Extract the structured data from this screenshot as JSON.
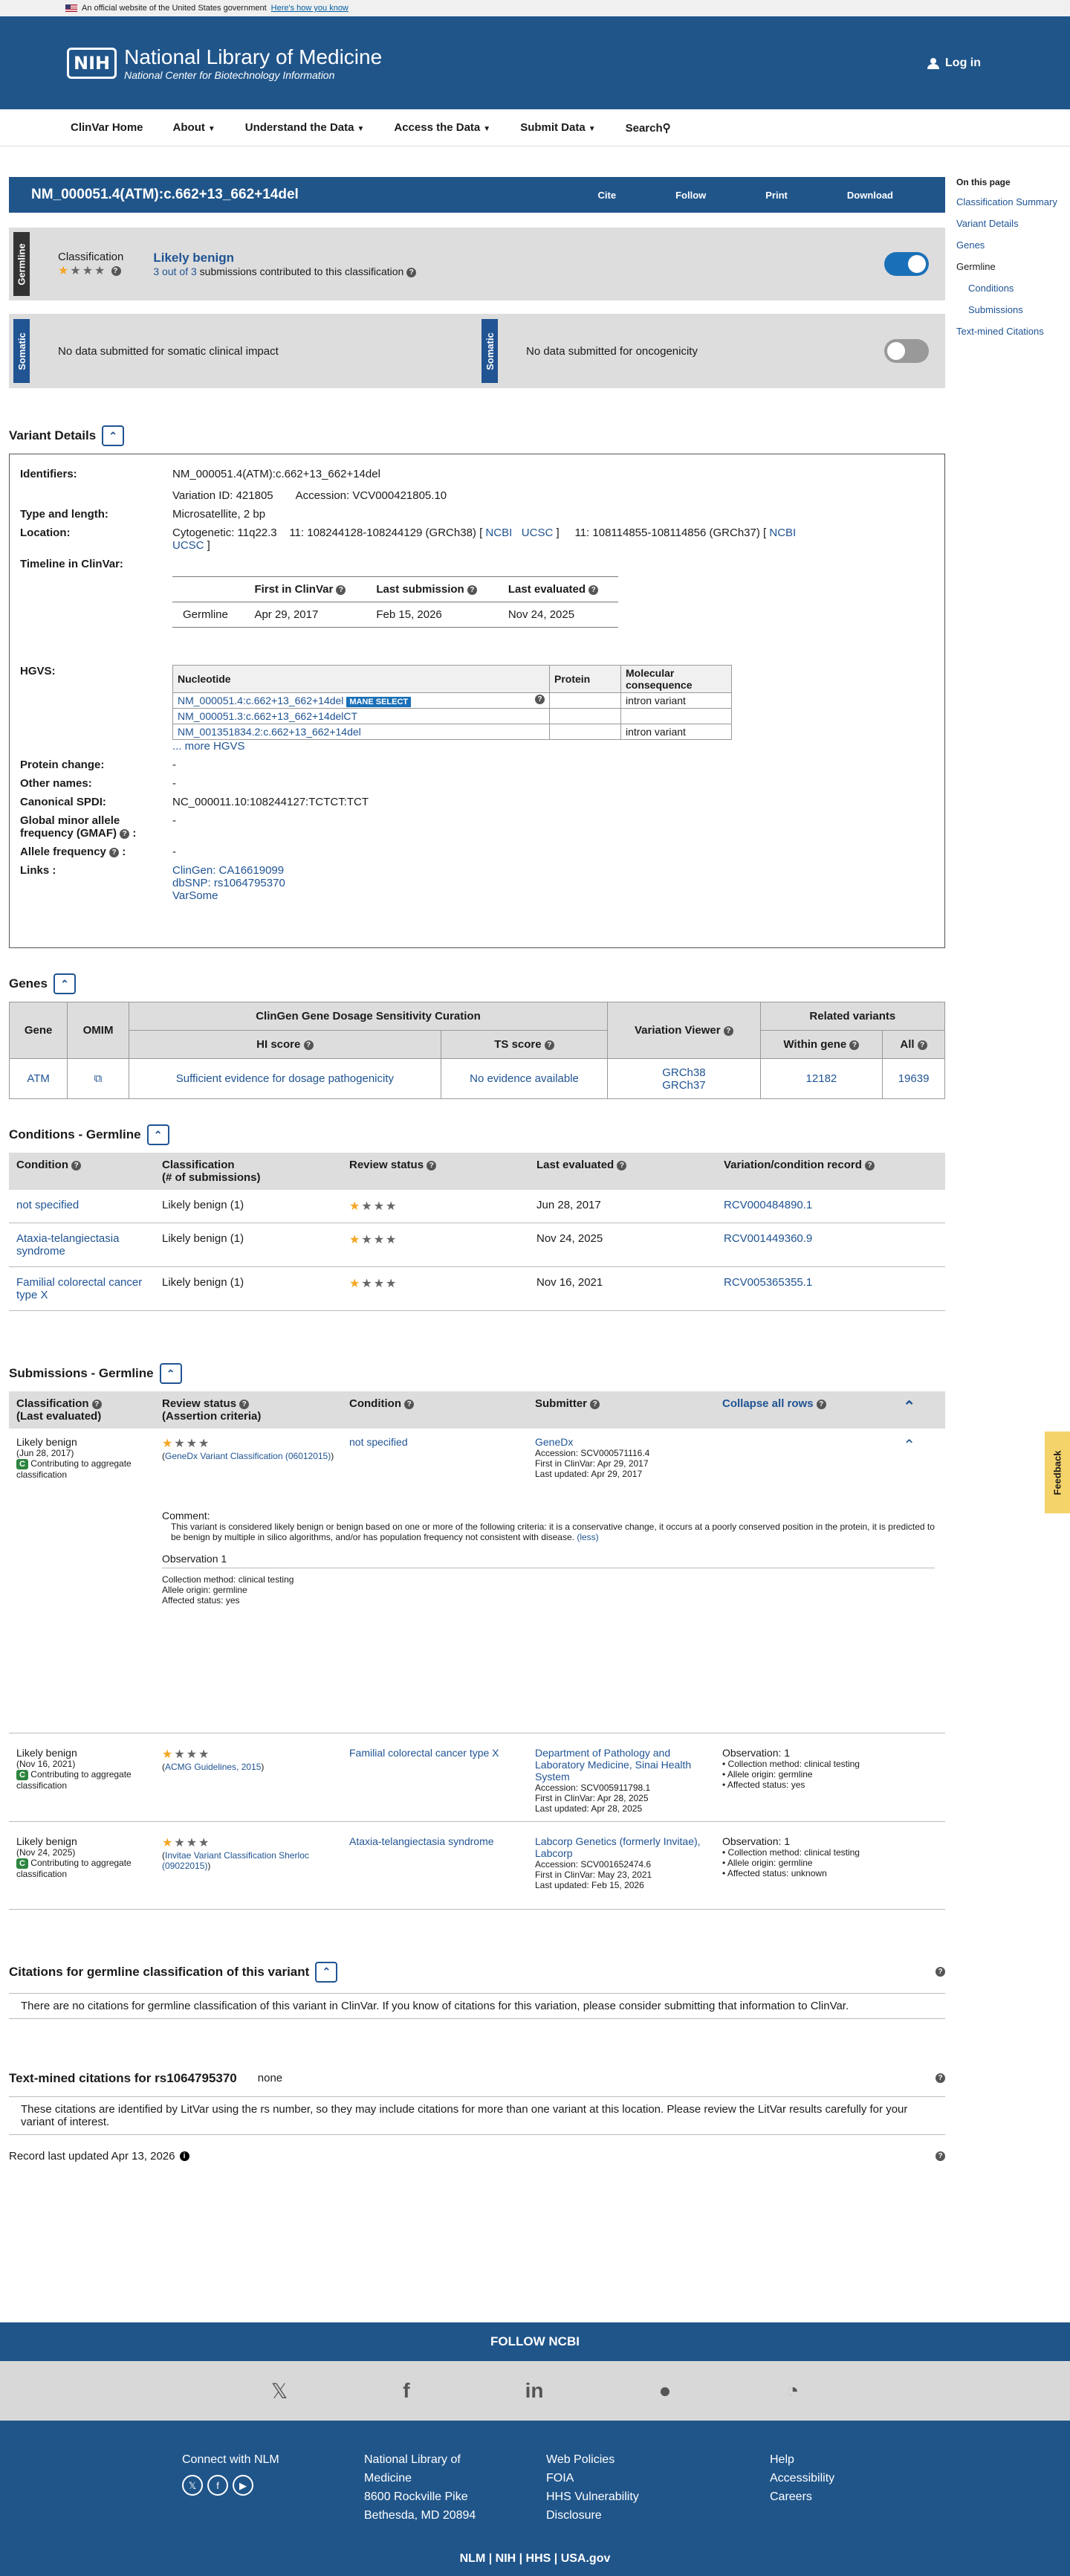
{
  "gov": {
    "text": "An official website of the United States government",
    "link": "Here's how you know"
  },
  "header": {
    "logo": "NIH",
    "title": "National Library of Medicine",
    "subtitle": "National Center for Biotechnology Information",
    "login": "Log in"
  },
  "nav": [
    "ClinVar Home",
    "About",
    "Understand the Data",
    "Access the Data",
    "Submit Data",
    "Search"
  ],
  "variant": {
    "title": "NM_000051.4(ATM):c.662+13_662+14del",
    "actions": [
      "Cite",
      "Follow",
      "Print",
      "Download"
    ]
  },
  "germline": {
    "tag": "Germline",
    "label": "Classification",
    "value": "Likely benign",
    "count": "3 out of 3",
    "count_rest": " submissions contributed to this classification",
    "stars_on": 1
  },
  "somatic": {
    "tag": "Somatic",
    "left": "No data submitted for somatic clinical impact",
    "right": "No data submitted for oncogenicity"
  },
  "sidebar": {
    "heading": "On this page",
    "items": [
      "Classification Summary",
      "Variant Details",
      "Genes",
      "Germline"
    ],
    "subitems": [
      "Conditions",
      "Submissions"
    ],
    "last": "Text-mined Citations"
  },
  "details": {
    "heading": "Variant Details",
    "identifiers_label": "Identifiers:",
    "identifiers": "NM_000051.4(ATM):c.662+13_662+14del",
    "variation_id": "Variation ID: 421805",
    "accession": "Accession: VCV000421805.10",
    "type_label": "Type and length:",
    "type": "Microsatellite, 2 bp",
    "location_label": "Location:",
    "cytogenetic": "Cytogenetic: 11q22.3",
    "grch38": "11: 108244128-108244129 (GRCh38) [",
    "ncbi": "NCBI",
    "ucsc": "UCSC",
    "grch37": "11: 108114855-108114856 (GRCh37) [",
    "timeline_label": "Timeline in ClinVar:",
    "timeline_headers": [
      "First in ClinVar",
      "Last submission",
      "Last evaluated"
    ],
    "timeline_row": [
      "Germline",
      "Apr 29, 2017",
      "Feb 15, 2026",
      "Nov 24, 2025"
    ],
    "hgvs_label": "HGVS:",
    "hgvs_headers": [
      "Nucleotide",
      "Protein",
      "Molecular consequence"
    ],
    "hgvs_rows": [
      {
        "n": "NM_000051.4:c.662+13_662+14del",
        "mane": "MANE SELECT",
        "p": "",
        "m": "intron variant"
      },
      {
        "n": "NM_000051.3:c.662+13_662+14delCT",
        "p": "",
        "m": ""
      },
      {
        "n": "NM_001351834.2:c.662+13_662+14del",
        "p": "",
        "m": "intron variant"
      }
    ],
    "more_hgvs": "... more HGVS",
    "protein_change_label": "Protein change:",
    "protein_change": "-",
    "other_names_label": "Other names:",
    "other_names": "-",
    "spdi_label": "Canonical SPDI:",
    "spdi": "NC_000011.10:108244127:TCTCT:TCT",
    "gmaf_label": "Global minor allele frequency (GMAF)",
    "gmaf": "-",
    "af_label": "Allele frequency",
    "af": "-",
    "links_label": "Links :",
    "links": [
      "ClinGen: CA16619099",
      "dbSNP: rs1064795370",
      "VarSome"
    ]
  },
  "genes": {
    "heading": "Genes",
    "h_gene": "Gene",
    "h_omim": "OMIM",
    "h_clingen": "ClinGen Gene Dosage Sensitivity Curation",
    "h_hi": "HI score",
    "h_ts": "TS score",
    "h_viewer": "Variation Viewer",
    "h_related": "Related variants",
    "h_within": "Within gene",
    "h_all": "All",
    "row": {
      "gene": "ATM",
      "hi": "Sufficient evidence for dosage pathogenicity",
      "ts": "No evidence available",
      "v1": "GRCh38",
      "v2": "GRCh37",
      "within": "12182",
      "all": "19639"
    }
  },
  "conditions": {
    "heading": "Conditions - Germline",
    "headers": [
      "Condition",
      "Classification",
      "(# of submissions)",
      "Review status",
      "Last evaluated",
      "Variation/condition record"
    ],
    "rows": [
      {
        "c": "not specified",
        "cl": "Likely benign (1)",
        "d": "Jun 28, 2017",
        "r": "RCV000484890.1"
      },
      {
        "c": "Ataxia-telangiectasia syndrome",
        "cl": "Likely benign (1)",
        "d": "Nov 24, 2025",
        "r": "RCV001449360.9"
      },
      {
        "c": "Familial colorectal cancer type X",
        "cl": "Likely benign (1)",
        "d": "Nov 16, 2021",
        "r": "RCV005365355.1"
      }
    ]
  },
  "submissions": {
    "heading": "Submissions - Germline",
    "headers": [
      "Classification",
      "(Last evaluated)",
      "Review status",
      "(Assertion criteria)",
      "Condition",
      "Submitter"
    ],
    "collapse": "Collapse all rows",
    "contrib": "Contributing to aggregate classification",
    "rows": [
      {
        "cls": "Likely benign",
        "date": "(Jun 28, 2017)",
        "crit": "GeneDx Variant Classification (06012015)",
        "cond": "not specified",
        "sub": "GeneDx",
        "acc": "Accession: SCV000571116.4",
        "first": "First in ClinVar: Apr 29, 2017",
        "last": "Last updated: Apr 29, 2017"
      },
      {
        "cls": "Likely benign",
        "date": "(Nov 16, 2021)",
        "crit": "ACMG Guidelines, 2015",
        "cond": "Familial colorectal cancer type X",
        "sub": "Department of Pathology and Laboratory Medicine, Sinai Health System",
        "acc": "Accession: SCV005911798.1",
        "first": "First in ClinVar: Apr 28, 2025",
        "last": "Last updated: Apr 28, 2025",
        "obs": "Observation: 1",
        "o1": "Collection method: clinical testing",
        "o2": "Allele origin: germline",
        "o3": "Affected status: yes"
      },
      {
        "cls": "Likely benign",
        "date": "(Nov 24, 2025)",
        "crit": "Invitae Variant Classification Sherloc (09022015)",
        "cond": "Ataxia-telangiectasia syndrome",
        "sub": "Labcorp Genetics (formerly Invitae), Labcorp",
        "acc": "Accession: SCV001652474.6",
        "first": "First in ClinVar: May 23, 2021",
        "last": "Last updated: Feb 15, 2026",
        "obs": "Observation: 1",
        "o1": "Collection method: clinical testing",
        "o2": "Allele origin: germline",
        "o3": "Affected status: unknown"
      }
    ],
    "comment_label": "Comment:",
    "comment": "This variant is considered likely benign or benign based on one or more of the following criteria: it is a conservative change, it occurs at a poorly conserved position in the protein, it is predicted to be benign by multiple in silico algorithms, and/or has population frequency not consistent with disease.",
    "less": "(less)",
    "obs1_label": "Observation 1",
    "obs1": [
      "Collection method: clinical testing",
      "Allele origin: germline",
      "Affected status: yes"
    ]
  },
  "citations": {
    "heading": "Citations for germline classification of this variant",
    "text": "There are no citations for germline classification of this variant in ClinVar. If you know of citations for this variation, please consider submitting that information to ClinVar."
  },
  "textmined": {
    "heading": "Text-mined citations for rs1064795370",
    "none": "none",
    "text": "These citations are identified by LitVar using the rs number, so they may include citations for more than one variant at this location. Please review the LitVar results carefully for your variant of interest."
  },
  "record": "Record last updated Apr 13, 2026",
  "feedback": "Feedback",
  "footer": {
    "follow": "FOLLOW NCBI",
    "connect": "Connect with NLM",
    "addr": [
      "National Library of",
      "Medicine",
      "8600 Rockville Pike",
      "Bethesda, MD 20894"
    ],
    "policies": [
      "Web Policies",
      "FOIA",
      "HHS Vulnerability",
      "Disclosure"
    ],
    "help": [
      "Help",
      "Accessibility",
      "Careers"
    ],
    "bottom": "NLM | NIH | HHS | USA.gov"
  }
}
